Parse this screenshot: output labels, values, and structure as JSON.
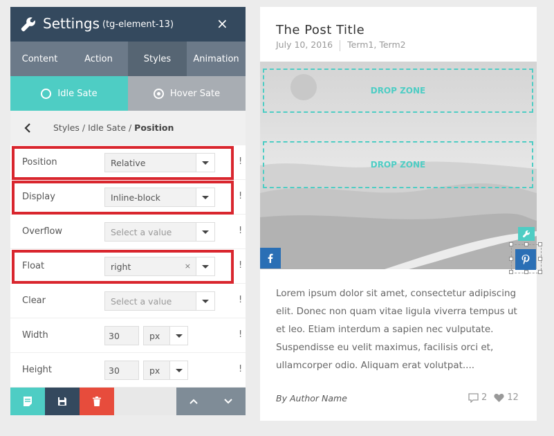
{
  "settings": {
    "title": "Settings",
    "element_id": "(tg-element-13)",
    "close": "×",
    "tabs": [
      {
        "label": "Content"
      },
      {
        "label": "Action"
      },
      {
        "label": "Styles"
      },
      {
        "label": "Animation"
      }
    ],
    "active_tab": "Styles",
    "states": [
      {
        "label": "Idle Sate"
      },
      {
        "label": "Hover Sate"
      }
    ],
    "breadcrumb": {
      "path": "Styles / Idle Sate / ",
      "current": "Position"
    },
    "fields": [
      {
        "label": "Position",
        "value": "Relative"
      },
      {
        "label": "Display",
        "value": "Inline-block"
      },
      {
        "label": "Overflow",
        "placeholder": "Select a value"
      },
      {
        "label": "Float",
        "value": "right",
        "clear": "×"
      },
      {
        "label": "Clear",
        "placeholder": "Select a value"
      },
      {
        "label": "Width",
        "value": "30",
        "unit": "px"
      },
      {
        "label": "Height",
        "value": "30",
        "unit": "px"
      }
    ],
    "important_mark": "!",
    "colors": {
      "header": "#34495e",
      "accent": "#4ecdc4",
      "highlight": "#d9262e",
      "delete": "#e74c3c"
    }
  },
  "post": {
    "title": "The Post Title",
    "date": "July 10, 2016",
    "terms": "Term1, Term2",
    "drop_zone_label": "DROP ZONE",
    "excerpt": "Lorem ipsum dolor sit amet, consectetur adipiscing elit. Donec non quam vitae ligula viverra tempus ut et leo. Etiam interdum a sapien nec vulputate. Suspendisse eu velit maximus, facilisis orci et, ullamcorper odio. Aliquam erat volutpat....",
    "author": "By Author Name",
    "comments": "2",
    "likes": "12"
  }
}
